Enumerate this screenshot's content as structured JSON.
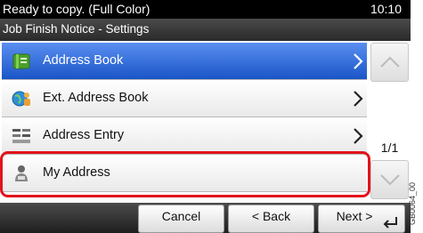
{
  "status": {
    "message": "Ready to copy. (Full Color)",
    "time": "10:10"
  },
  "title": "Job Finish Notice - Settings",
  "items": [
    {
      "label": "Address Book",
      "icon": "address-book-icon",
      "selected": true
    },
    {
      "label": "Ext. Address Book",
      "icon": "ext-address-book-icon",
      "selected": false
    },
    {
      "label": "Address Entry",
      "icon": "address-entry-icon",
      "selected": false
    },
    {
      "label": "My Address",
      "icon": "my-address-icon",
      "selected": false,
      "highlighted": true
    }
  ],
  "pager": {
    "indicator": "1/1"
  },
  "footer": {
    "cancel": "Cancel",
    "back": "< Back",
    "next": "Next >"
  },
  "figure_code": "GB0064_00",
  "colors": {
    "selected": "#1a55c8",
    "highlight": "#e3131b",
    "status_bg": "#000000"
  }
}
